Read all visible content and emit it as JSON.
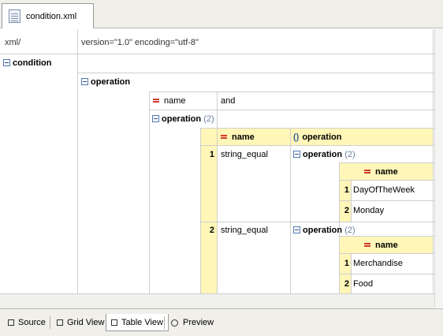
{
  "editor_tab": {
    "filename": "condition.xml"
  },
  "xml_declaration": {
    "label": "xml/",
    "value": "version=\"1.0\" encoding=\"utf-8\""
  },
  "root": {
    "element": "condition",
    "operation_element": "operation",
    "name_attr": "name",
    "name_value": "and",
    "nested_element": "operation",
    "nested_count": "(2)",
    "table_headers": {
      "name": "name",
      "operation": "operation"
    },
    "rows": [
      {
        "index": "1",
        "name": "string_equal",
        "operation_label": "operation",
        "operation_count": "(2)",
        "sub_header": "name",
        "sub_rows": [
          {
            "index": "1",
            "value": "DayOfTheWeek"
          },
          {
            "index": "2",
            "value": "Monday"
          }
        ]
      },
      {
        "index": "2",
        "name": "string_equal",
        "operation_label": "operation",
        "operation_count": "(2)",
        "sub_header": "name",
        "sub_rows": [
          {
            "index": "1",
            "value": "Merchandise"
          },
          {
            "index": "2",
            "value": "Food"
          }
        ]
      }
    ]
  },
  "bottom_tabs": {
    "source": "Source",
    "grid": "Grid View",
    "table": "Table View",
    "preview": "Preview",
    "active": "Table View"
  },
  "colors": {
    "header_fill": "#fff6b8",
    "grid_line": "#cfcfcf",
    "attr_marker": "#d23a2a",
    "expand_icon": "#4f78b0"
  }
}
